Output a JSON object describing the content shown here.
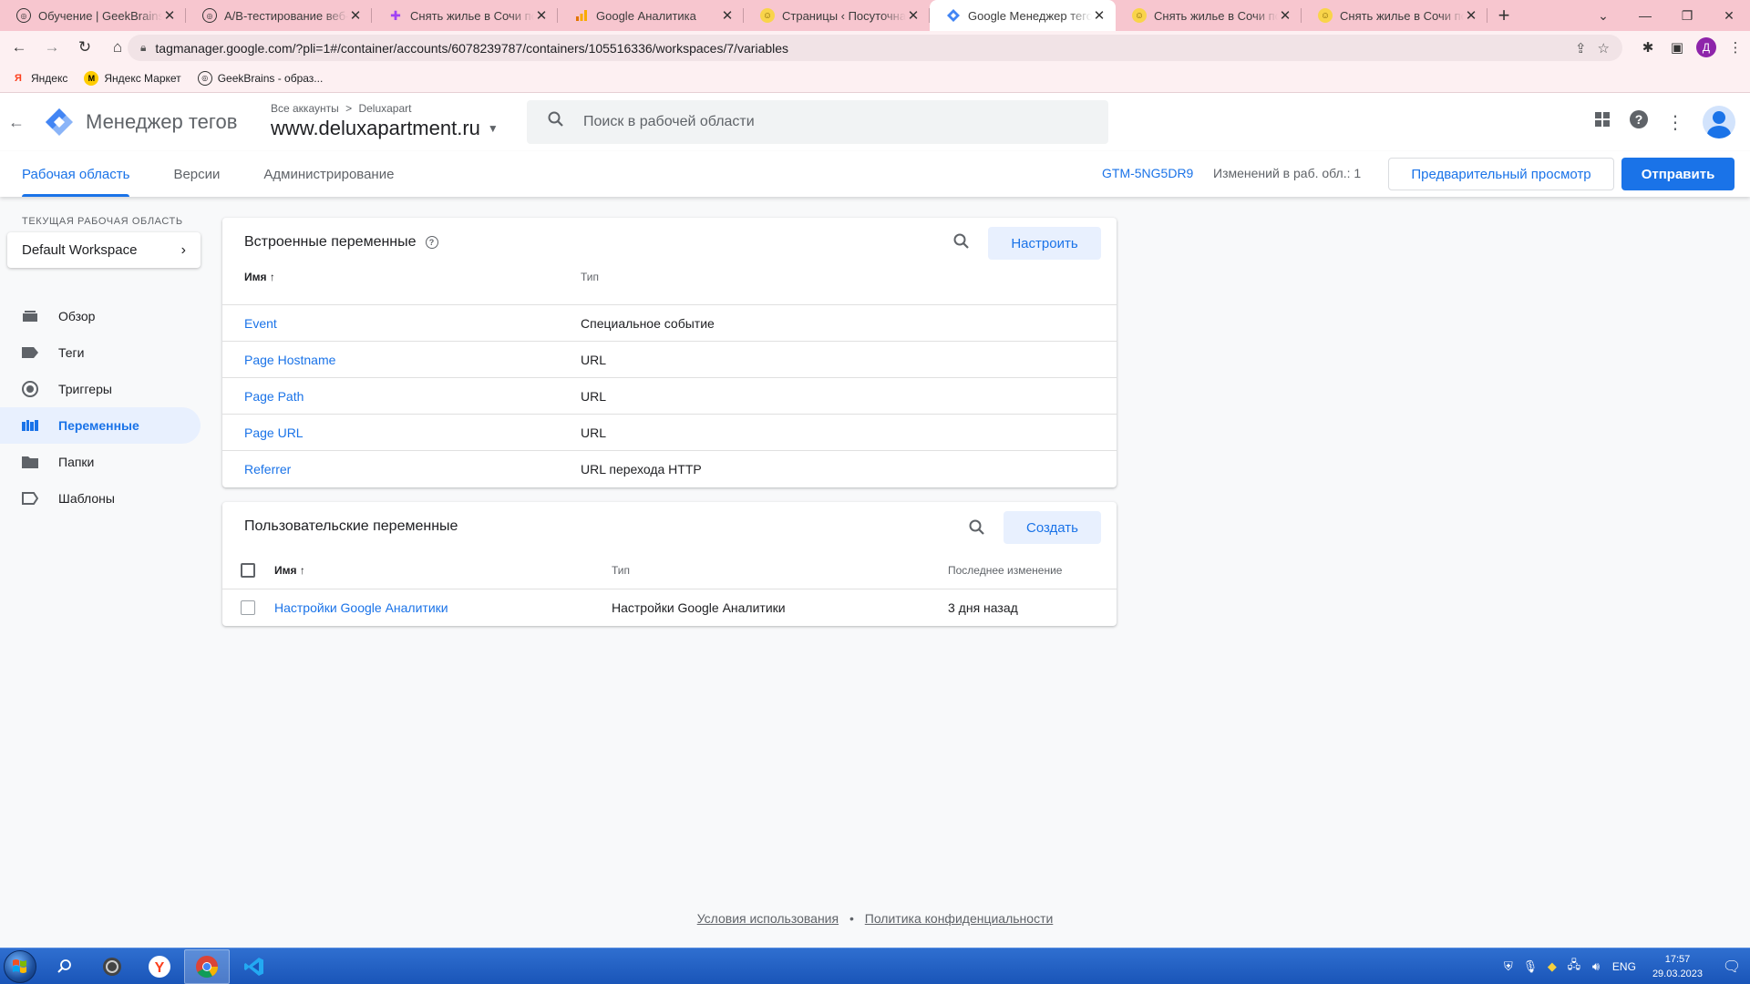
{
  "browser": {
    "tabs": [
      {
        "title": "Обучение | GeekBrains - о",
        "favicon": "geekbrains-icon",
        "active": false
      },
      {
        "title": "A/B-тестирование веб-пр",
        "favicon": "geekbrains-icon",
        "active": false
      },
      {
        "title": "Снять жилье в Сочи посу",
        "favicon": "site-icon",
        "active": false
      },
      {
        "title": "Google Аналитика",
        "favicon": "analytics-icon",
        "active": false
      },
      {
        "title": "Страницы ‹ Посуточная а",
        "favicon": "smiley-icon",
        "active": false
      },
      {
        "title": "Google Менеджер тегов",
        "favicon": "gtm-icon",
        "active": true
      },
      {
        "title": "Снять жилье в Сочи посу",
        "favicon": "smiley-icon",
        "active": false
      },
      {
        "title": "Снять жилье в Сочи посу",
        "favicon": "smiley-icon",
        "active": false
      }
    ],
    "url": "tagmanager.google.com/?pli=1#/container/accounts/6078239787/containers/105516336/workspaces/7/variables",
    "profile_initial": "Д",
    "bookmarks": [
      {
        "label": "Яндекс",
        "icon": "yandex-icon"
      },
      {
        "label": "Яндекс Маркет",
        "icon": "market-icon"
      },
      {
        "label": "GeekBrains - образ...",
        "icon": "geekbrains-icon"
      }
    ]
  },
  "header": {
    "product_name": "Менеджер тегов",
    "breadcrumb_accounts": "Все аккаунты",
    "breadcrumb_separator": ">",
    "breadcrumb_account": "Deluxapart",
    "container_name": "www.deluxapartment.ru",
    "search_placeholder": "Поиск в рабочей области"
  },
  "nav": {
    "tabs": [
      {
        "label": "Рабочая область",
        "active": true
      },
      {
        "label": "Версии",
        "active": false
      },
      {
        "label": "Администрирование",
        "active": false
      }
    ],
    "container_id": "GTM-5NG5DR9",
    "changes": "Изменений в раб. обл.: 1",
    "preview_label": "Предварительный просмотр",
    "submit_label": "Отправить"
  },
  "sidebar": {
    "workspace_label": "ТЕКУЩАЯ РАБОЧАЯ ОБЛАСТЬ",
    "workspace_name": "Default Workspace",
    "items": [
      {
        "label": "Обзор",
        "icon": "overview-icon",
        "active": false
      },
      {
        "label": "Теги",
        "icon": "tag-icon",
        "active": false
      },
      {
        "label": "Триггеры",
        "icon": "trigger-icon",
        "active": false
      },
      {
        "label": "Переменные",
        "icon": "variables-icon",
        "active": true
      },
      {
        "label": "Папки",
        "icon": "folder-icon",
        "active": false
      },
      {
        "label": "Шаблоны",
        "icon": "template-icon",
        "active": false
      }
    ]
  },
  "builtin": {
    "title": "Встроенные переменные",
    "configure_label": "Настроить",
    "col_name": "Имя",
    "col_type": "Тип",
    "rows": [
      {
        "name": "Event",
        "type": "Специальное событие"
      },
      {
        "name": "Page Hostname",
        "type": "URL"
      },
      {
        "name": "Page Path",
        "type": "URL"
      },
      {
        "name": "Page URL",
        "type": "URL"
      },
      {
        "name": "Referrer",
        "type": "URL перехода HTTP"
      }
    ]
  },
  "custom": {
    "title": "Пользовательские переменные",
    "create_label": "Создать",
    "col_name": "Имя",
    "col_type": "Тип",
    "col_modified": "Последнее изменение",
    "rows": [
      {
        "name": "Настройки Google Аналитики",
        "type": "Настройки Google Аналитики",
        "modified": "3 дня назад"
      }
    ]
  },
  "footer": {
    "terms": "Условия использования",
    "separator": "•",
    "privacy": "Политика конфиденциальности"
  },
  "taskbar": {
    "lang": "ENG",
    "time": "17:57",
    "date": "29.03.2023"
  },
  "colors": {
    "accent": "#1a73e8",
    "tabstrip": "#f7c6cf",
    "active_nav_bg": "#e8f0fe"
  }
}
